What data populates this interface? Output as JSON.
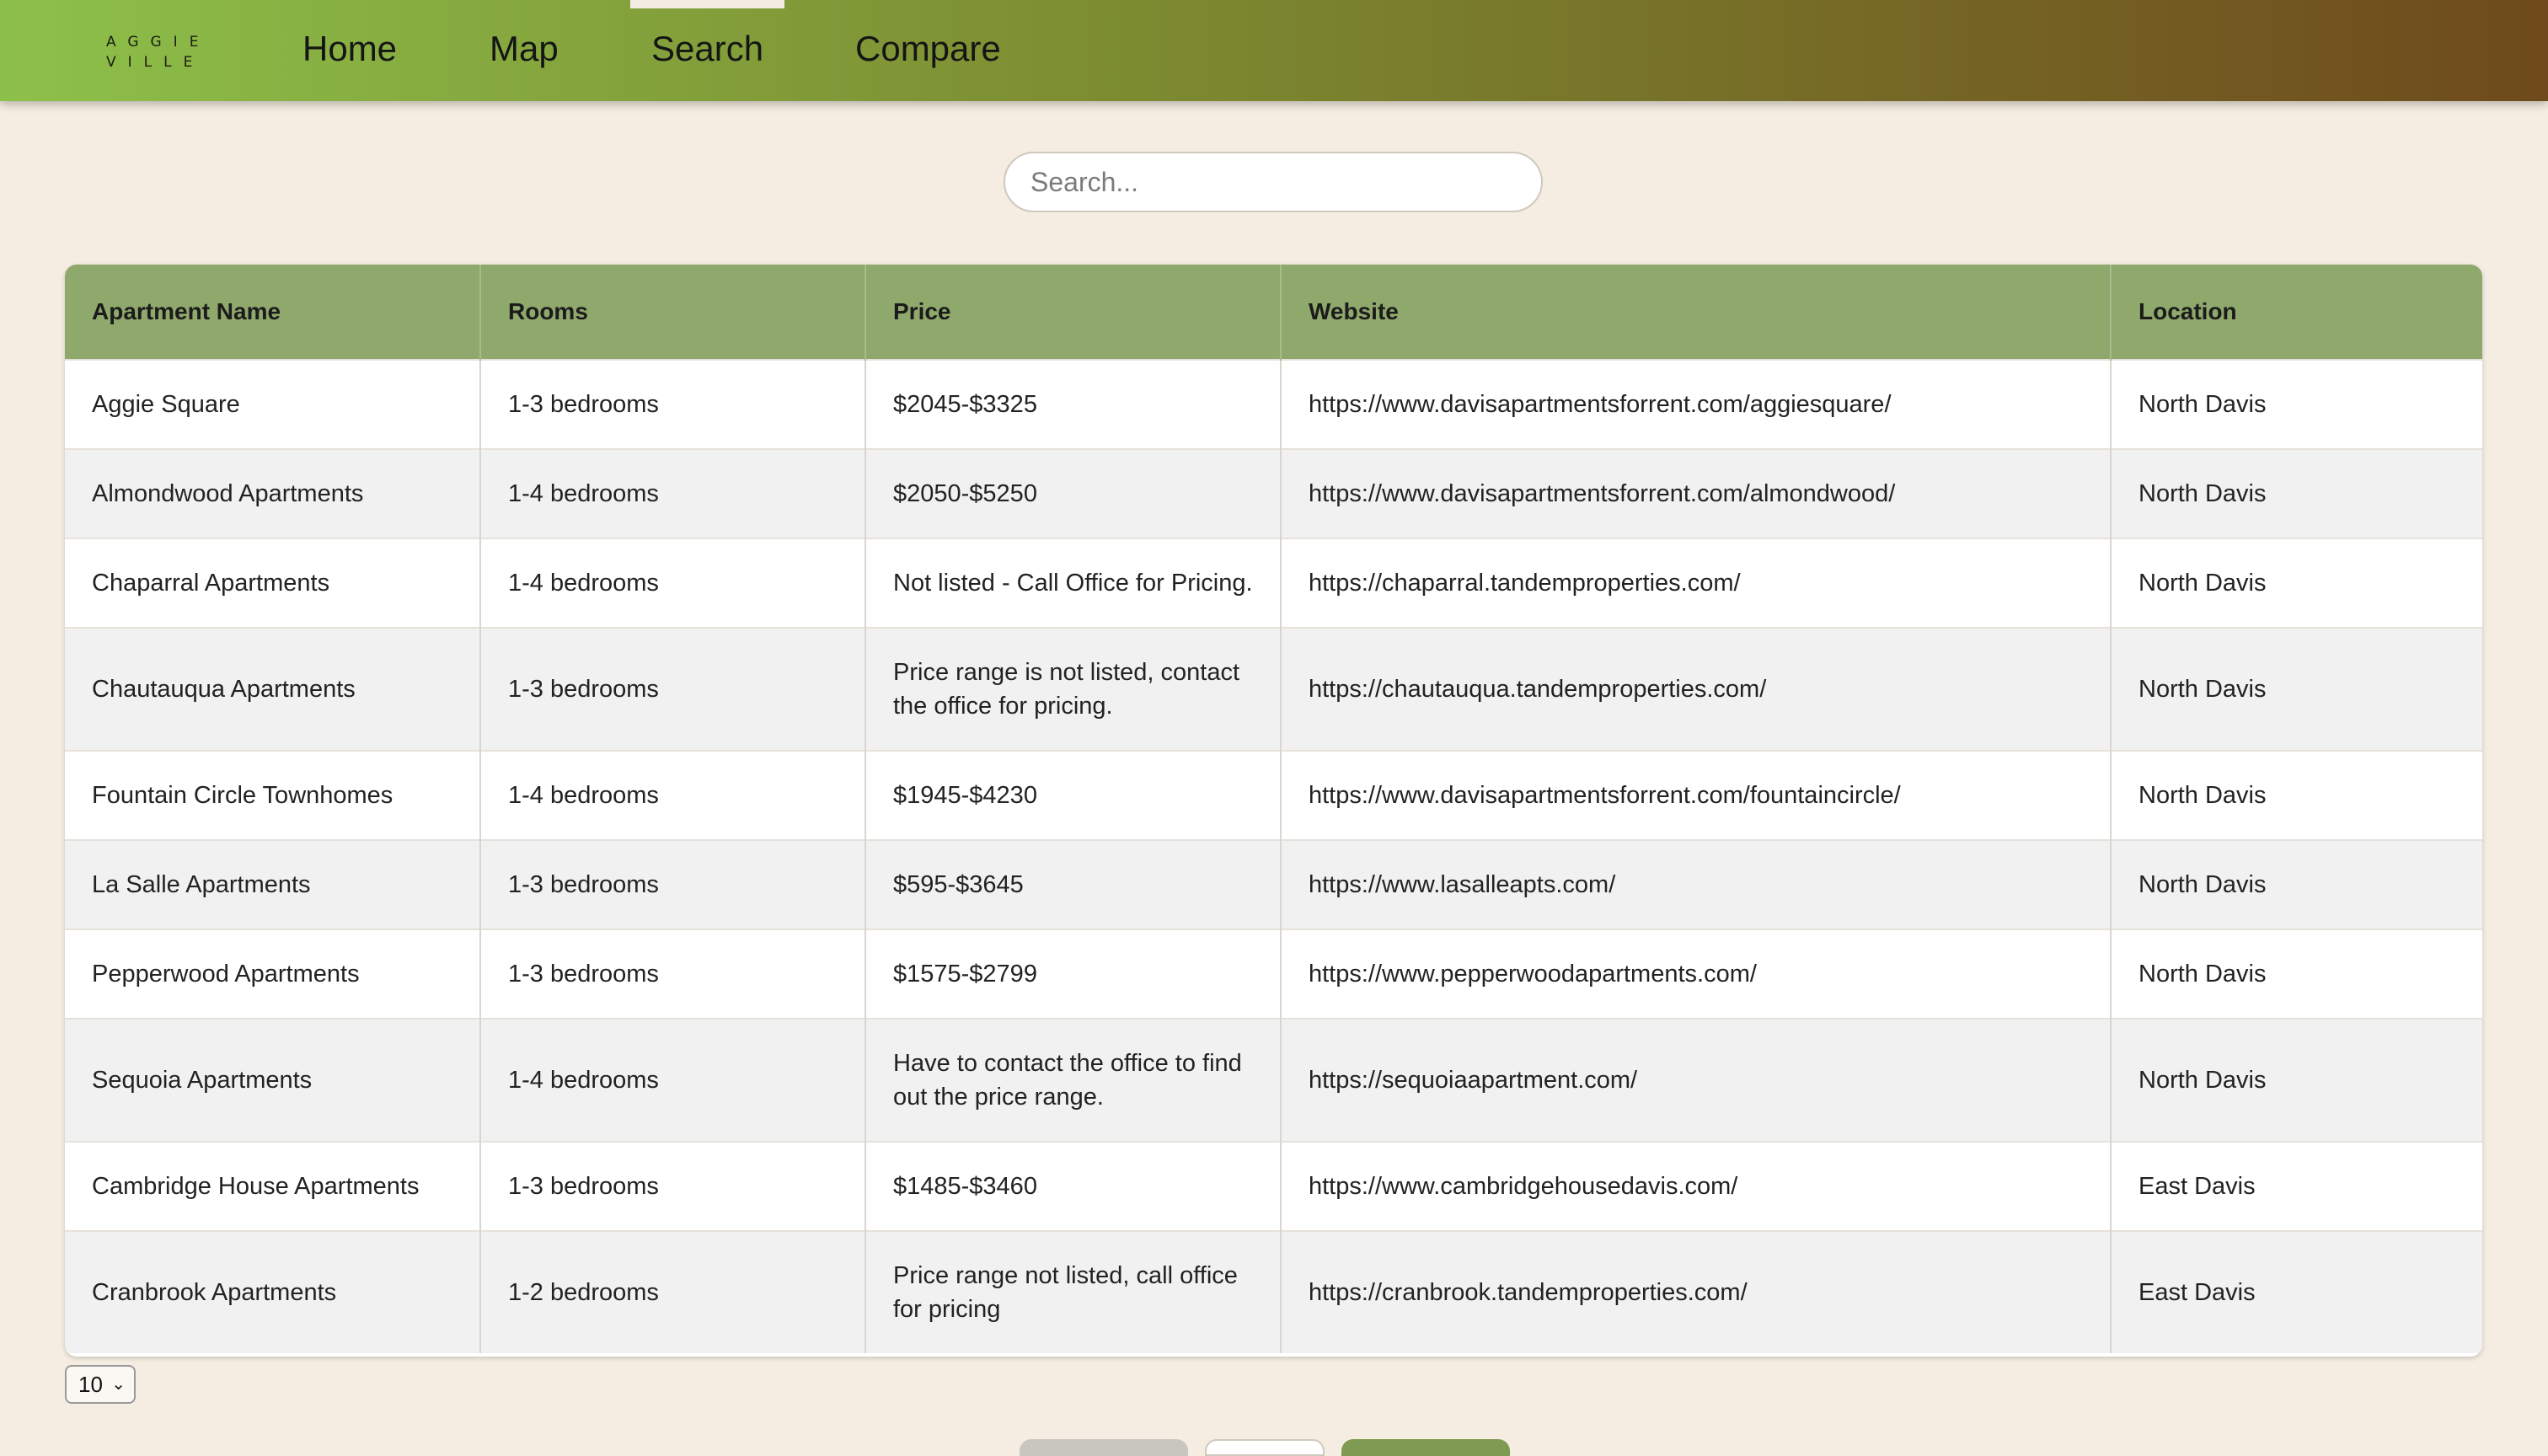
{
  "logo": {
    "line1": "AGGIE",
    "line2": "VILLE"
  },
  "nav": {
    "home": "Home",
    "map": "Map",
    "search": "Search",
    "compare": "Compare"
  },
  "search": {
    "placeholder": "Search..."
  },
  "table": {
    "headers": [
      "Apartment Name",
      "Rooms",
      "Price",
      "Website",
      "Location"
    ],
    "rows": [
      [
        "Aggie Square",
        "1-3 bedrooms",
        "$2045-$3325",
        "https://www.davisapartmentsforrent.com/aggiesquare/",
        "North Davis"
      ],
      [
        "Almondwood Apartments",
        "1-4 bedrooms",
        "$2050-$5250",
        "https://www.davisapartmentsforrent.com/almondwood/",
        "North Davis"
      ],
      [
        "Chaparral Apartments",
        "1-4 bedrooms",
        "Not listed - Call Office for Pricing.",
        "https://chaparral.tandemproperties.com/",
        "North Davis"
      ],
      [
        "Chautauqua Apartments",
        "1-3 bedrooms",
        "Price range is not listed, contact the office for pricing.",
        "https://chautauqua.tandemproperties.com/",
        "North Davis"
      ],
      [
        "Fountain Circle Townhomes",
        "1-4 bedrooms",
        "$1945-$4230",
        "https://www.davisapartmentsforrent.com/fountaincircle/",
        "North Davis"
      ],
      [
        "La Salle Apartments",
        "1-3 bedrooms",
        "$595-$3645",
        "https://www.lasalleapts.com/",
        "North Davis"
      ],
      [
        "Pepperwood Apartments",
        "1-3 bedrooms",
        "$1575-$2799",
        "https://www.pepperwoodapartments.com/",
        "North Davis"
      ],
      [
        "Sequoia Apartments",
        "1-4 bedrooms",
        "Have to contact the office to find out the price range.",
        "https://sequoiaapartment.com/",
        "North Davis"
      ],
      [
        "Cambridge House Apartments",
        "1-3 bedrooms",
        "$1485-$3460",
        "https://www.cambridgehousedavis.com/",
        "East Davis"
      ],
      [
        "Cranbrook Apartments",
        "1-2 bedrooms",
        "Price range not listed, call office for pricing",
        "https://cranbrook.tandemproperties.com/",
        "East Davis"
      ]
    ]
  },
  "pagination": {
    "page_size": "10"
  },
  "colors": {
    "header_bg": "#8fa86b",
    "page_bg": "#f5ede1",
    "nav_left": "#8dc04a",
    "nav_right": "#6f4a1c"
  }
}
